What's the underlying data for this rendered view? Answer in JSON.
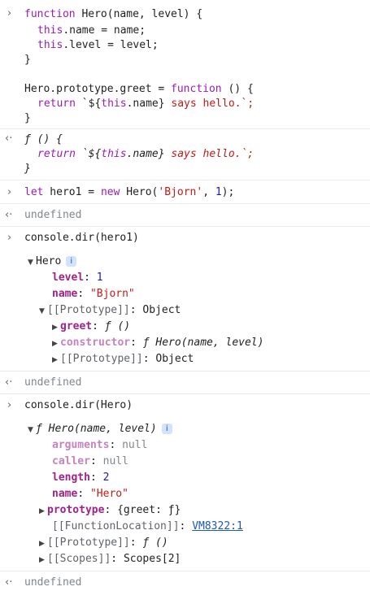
{
  "icons": {
    "input_prompt": "›",
    "output_prompt": "‹·",
    "expanded": "▼",
    "collapsed": "▶",
    "info": "i"
  },
  "entries": {
    "def": {
      "l1_kw": "function",
      "l1_rest": " Hero(name, level) {",
      "l2_this": "this",
      "l2_rest": ".name = name;",
      "l3_this": "this",
      "l3_rest": ".level = level;",
      "l4": "}",
      "l6_pre": "Hero.prototype.greet = ",
      "l6_kw": "function",
      "l6_rest": " () {",
      "l7_kw": "return",
      "l7_a": " `${",
      "l7_this": "this",
      "l7_b": ".name}",
      "l7_str": " says hello.",
      "l7_c": "`;",
      "l8": "}"
    },
    "fn_output": {
      "l1": "ƒ () {",
      "l2_kw": "return",
      "l2_a": " `${",
      "l2_this": "this",
      "l2_b": ".name}",
      "l2_str": " says hello.",
      "l2_c": "`;",
      "l3": "}"
    },
    "hero1": {
      "kw_let": "let",
      "mid": " hero1 = ",
      "kw_new": "new",
      "call": " Hero(",
      "arg1": "'Bjorn'",
      "sep": ", ",
      "arg2": "1",
      "end": ");"
    },
    "undefined_1": "undefined",
    "dir_hero1_cmd": "console.dir(hero1)",
    "hero1_obj": {
      "title": "Hero",
      "level_key": "level",
      "level_val": "1",
      "name_key": "name",
      "name_val": "\"Bjorn\"",
      "proto_label": "[[Prototype]]",
      "proto_val": "Object",
      "greet_key": "greet",
      "greet_val": "ƒ ()",
      "ctor_key": "constructor",
      "ctor_val": "ƒ Hero(name, level)",
      "proto2_label": "[[Prototype]]",
      "proto2_val": "Object"
    },
    "undefined_2": "undefined",
    "dir_hero_cmd": "console.dir(Hero)",
    "hero_fn": {
      "title": "ƒ Hero(name, level)",
      "args_key": "arguments",
      "args_val": "null",
      "caller_key": "caller",
      "caller_val": "null",
      "length_key": "length",
      "length_val": "2",
      "name_key": "name",
      "name_val": "\"Hero\"",
      "proto_key": "prototype",
      "proto_val": "{greet: ƒ}",
      "fl_label": "[[FunctionLocation]]",
      "fl_link": "VM8322:1",
      "p2_label": "[[Prototype]]",
      "p2_val": "ƒ ()",
      "scopes_label": "[[Scopes]]",
      "scopes_val": "Scopes[2]"
    },
    "undefined_3": "undefined"
  }
}
